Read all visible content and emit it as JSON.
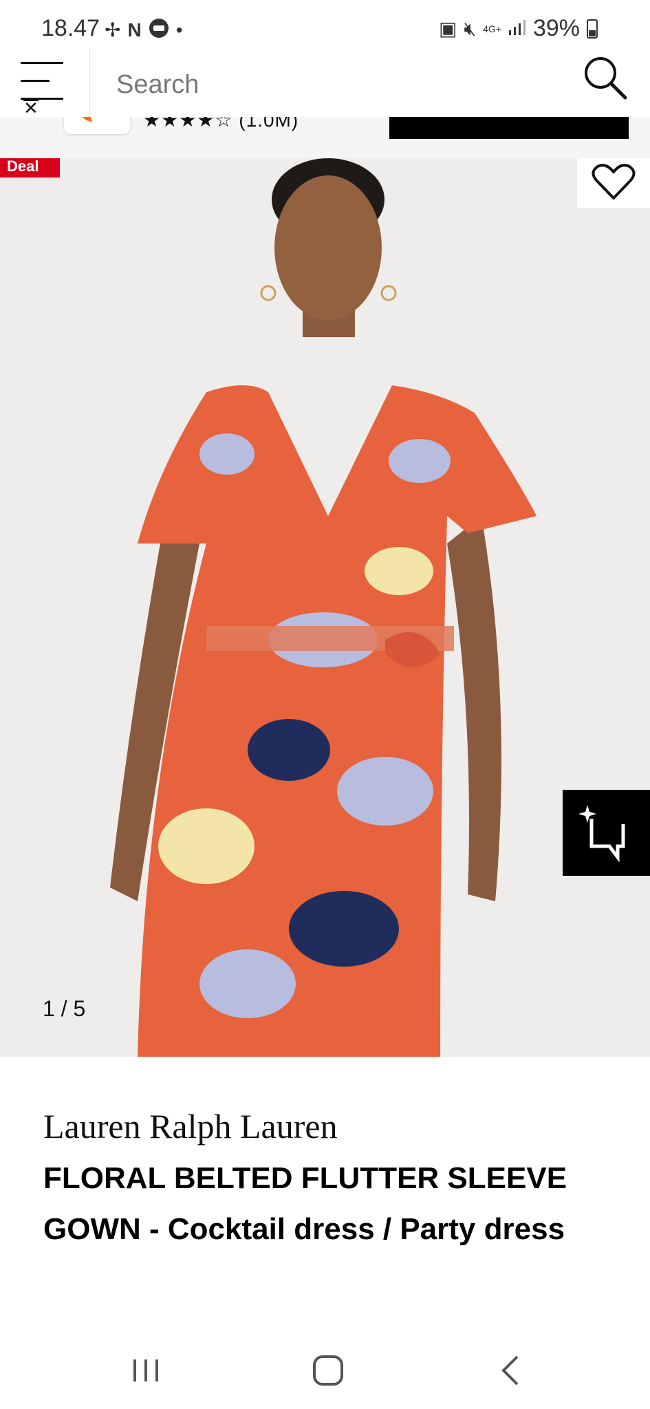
{
  "status_bar": {
    "time": "18.47",
    "battery": "39%",
    "network": "4G+"
  },
  "header": {
    "rating_stars": "★★★★☆",
    "rating_count": "(1.0M)"
  },
  "search": {
    "placeholder": "Search"
  },
  "product": {
    "deal_badge": "Deal",
    "image_counter": "1 / 5",
    "brand": "Lauren Ralph Lauren",
    "name": "FLORAL BELTED FLUTTER SLEEVE GOWN - Cocktail dress / Party dress"
  },
  "colors": {
    "accent": "#ff6900",
    "deal_red": "#d8001b",
    "image_bg": "#efedeb"
  }
}
